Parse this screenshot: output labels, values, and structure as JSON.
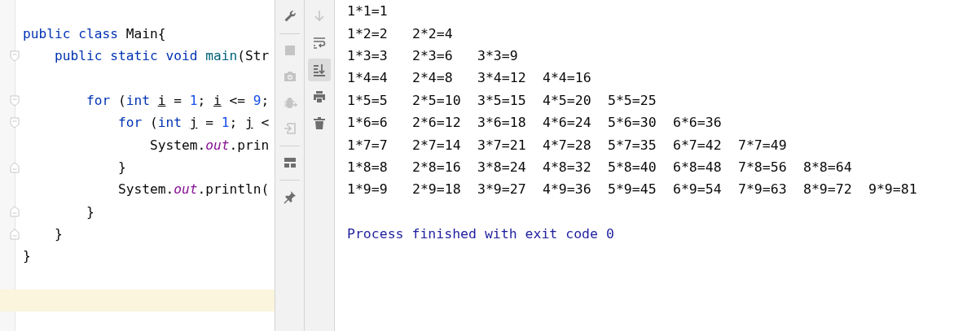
{
  "editor": {
    "lines": [
      {
        "fold_start": false,
        "fold_end": false,
        "current": false,
        "tokens": [
          {
            "kind": "kw",
            "text": "public"
          },
          {
            "kind": "kw",
            "text": " class"
          },
          {
            "kind": "plain",
            "text": " Main{"
          }
        ]
      },
      {
        "fold_start": true,
        "fold_end": false,
        "current": false,
        "tokens": [
          {
            "kind": "kw",
            "text": "    public"
          },
          {
            "kind": "kw",
            "text": " static"
          },
          {
            "kind": "kw",
            "text": " void"
          },
          {
            "kind": "method",
            "text": " main"
          },
          {
            "kind": "plain",
            "text": "(Str"
          }
        ]
      },
      {
        "fold_start": false,
        "fold_end": false,
        "current": false
      },
      {
        "fold_start": true,
        "fold_end": false,
        "current": false,
        "tokens": [
          {
            "kind": "kw",
            "text": "        for"
          },
          {
            "kind": "plain",
            "text": " ("
          },
          {
            "kind": "kw",
            "text": "int "
          },
          {
            "kind": "var",
            "text": "i"
          },
          {
            "kind": "plain",
            "text": " ="
          },
          {
            "kind": "num",
            "text": " 1"
          },
          {
            "kind": "plain",
            "text": "; "
          },
          {
            "kind": "var",
            "text": "i"
          },
          {
            "kind": "plain",
            "text": " <="
          },
          {
            "kind": "num",
            "text": " 9"
          },
          {
            "kind": "plain",
            "text": ";"
          }
        ]
      },
      {
        "fold_start": true,
        "fold_end": false,
        "current": false,
        "tokens": [
          {
            "kind": "kw",
            "text": "            for"
          },
          {
            "kind": "plain",
            "text": " ("
          },
          {
            "kind": "kw",
            "text": "int "
          },
          {
            "kind": "var",
            "text": "j"
          },
          {
            "kind": "plain",
            "text": " ="
          },
          {
            "kind": "num",
            "text": " 1"
          },
          {
            "kind": "plain",
            "text": "; "
          },
          {
            "kind": "var",
            "text": "j"
          },
          {
            "kind": "plain",
            "text": " <"
          }
        ]
      },
      {
        "fold_start": false,
        "fold_end": false,
        "current": false,
        "tokens": [
          {
            "kind": "plain",
            "text": "                System."
          },
          {
            "kind": "field",
            "text": "out"
          },
          {
            "kind": "plain",
            "text": ".prin"
          }
        ]
      },
      {
        "fold_start": false,
        "fold_end": true,
        "current": false,
        "tokens": [
          {
            "kind": "plain",
            "text": "            }"
          }
        ]
      },
      {
        "fold_start": false,
        "fold_end": false,
        "current": false,
        "tokens": [
          {
            "kind": "plain",
            "text": "            System."
          },
          {
            "kind": "field",
            "text": "out"
          },
          {
            "kind": "plain",
            "text": ".println("
          }
        ]
      },
      {
        "fold_start": false,
        "fold_end": true,
        "current": false,
        "tokens": [
          {
            "kind": "plain",
            "text": "        }"
          }
        ]
      },
      {
        "fold_start": false,
        "fold_end": true,
        "current": false,
        "tokens": [
          {
            "kind": "plain",
            "text": "    }"
          }
        ]
      },
      {
        "fold_start": false,
        "fold_end": false,
        "current": false,
        "tokens": [
          {
            "kind": "plain",
            "text": "}"
          }
        ]
      },
      {
        "fold_start": false,
        "fold_end": false,
        "current": false
      },
      {
        "fold_start": false,
        "fold_end": false,
        "current": true
      }
    ]
  },
  "run_toolbar": [
    {
      "kind": "wrench",
      "disabled": false
    },
    {
      "kind": "separator"
    },
    {
      "kind": "stop",
      "disabled": true
    },
    {
      "kind": "camera",
      "disabled": true
    },
    {
      "kind": "bug",
      "disabled": true
    },
    {
      "kind": "exit",
      "disabled": true
    },
    {
      "kind": "separator"
    },
    {
      "kind": "layout",
      "disabled": false
    },
    {
      "kind": "separator"
    },
    {
      "kind": "pin",
      "disabled": false
    }
  ],
  "console_toolbar": [
    {
      "kind": "down",
      "disabled": true,
      "selected": false
    },
    {
      "kind": "wrap",
      "disabled": false,
      "selected": false
    },
    {
      "kind": "scroll-end",
      "disabled": false,
      "selected": true
    },
    {
      "kind": "print",
      "disabled": false,
      "selected": false
    },
    {
      "kind": "trash",
      "disabled": false,
      "selected": false
    }
  ],
  "console": {
    "lines": [
      {
        "kind": "output",
        "cells": [
          "1*1=1"
        ]
      },
      {
        "kind": "output",
        "cells": [
          "1*2=2",
          "2*2=4"
        ]
      },
      {
        "kind": "output",
        "cells": [
          "1*3=3",
          "2*3=6",
          "3*3=9"
        ]
      },
      {
        "kind": "output",
        "cells": [
          "1*4=4",
          "2*4=8",
          "3*4=12",
          "4*4=16"
        ]
      },
      {
        "kind": "output",
        "cells": [
          "1*5=5",
          "2*5=10",
          "3*5=15",
          "4*5=20",
          "5*5=25"
        ]
      },
      {
        "kind": "output",
        "cells": [
          "1*6=6",
          "2*6=12",
          "3*6=18",
          "4*6=24",
          "5*6=30",
          "6*6=36"
        ]
      },
      {
        "kind": "output",
        "cells": [
          "1*7=7",
          "2*7=14",
          "3*7=21",
          "4*7=28",
          "5*7=35",
          "6*7=42",
          "7*7=49"
        ]
      },
      {
        "kind": "output",
        "cells": [
          "1*8=8",
          "2*8=16",
          "3*8=24",
          "4*8=32",
          "5*8=40",
          "6*8=48",
          "7*8=56",
          "8*8=64"
        ]
      },
      {
        "kind": "output",
        "cells": [
          "1*9=9",
          "2*9=18",
          "3*9=27",
          "4*9=36",
          "5*9=45",
          "6*9=54",
          "7*9=63",
          "8*9=72",
          "9*9=81"
        ]
      },
      {
        "kind": "blank"
      },
      {
        "kind": "status",
        "cells": [
          "Process finished with exit code 0"
        ]
      }
    ]
  }
}
